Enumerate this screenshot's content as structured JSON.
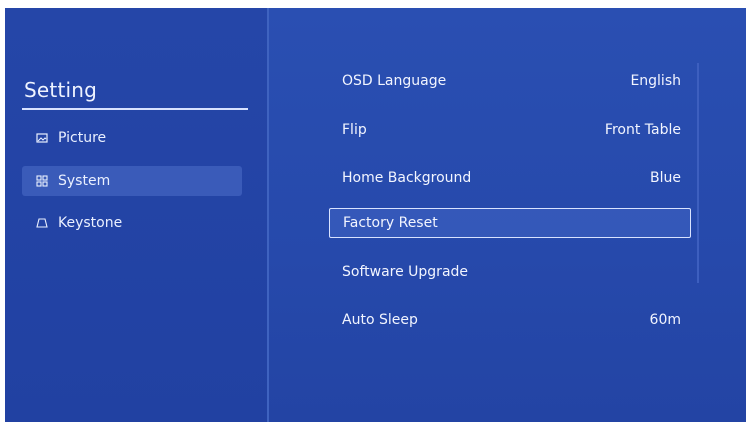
{
  "sidebar": {
    "title": "Setting",
    "items": [
      {
        "label": "Picture",
        "icon": "picture-icon",
        "active": false
      },
      {
        "label": "System",
        "icon": "system-icon",
        "active": true
      },
      {
        "label": "Keystone",
        "icon": "keystone-icon",
        "active": false
      }
    ]
  },
  "settings": {
    "rows": [
      {
        "label": "OSD Language",
        "value": "English"
      },
      {
        "label": "Flip",
        "value": "Front Table"
      },
      {
        "label": "Home Background",
        "value": "Blue"
      },
      {
        "label": "Factory Reset",
        "value": ""
      },
      {
        "label": "Software Upgrade",
        "value": ""
      },
      {
        "label": "Auto Sleep",
        "value": "60m"
      }
    ],
    "focused_index": 3
  },
  "colors": {
    "panel_blue": "#2546a8",
    "main_blue": "#2a4fb2",
    "active_item": "#3a5bb9",
    "text": "#f2f5ff"
  }
}
